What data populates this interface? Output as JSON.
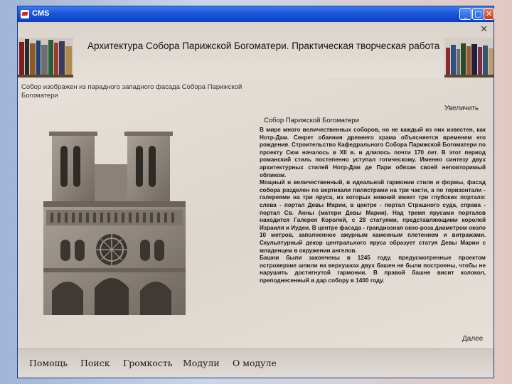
{
  "window": {
    "title": "CMS",
    "minimize_glyph": "_",
    "maximize_glyph": "□",
    "close_glyph": "✕",
    "inner_close_glyph": "✕"
  },
  "page": {
    "title": "Архитектура Собора Парижской Богоматери. Практическая творческая работа",
    "caption": "Собор изображен из парадного западного фасада Собора Парижской Богоматери",
    "enlarge_label": "Увеличить",
    "article_title": "Собор Парижской Богоматери",
    "article_text": "В мире много величественных соборов, но не каждый из них известен, как Нотр-Дам. Секрет обаяния древнего храма объясняется временем его рождения. Строительство Кафедрального Собора Парижской Богоматери по проекту Сюи началось в XII в. и длилось почти 170 лет. В этот период романский стиль постепенно уступал готическому. Именно синтезу двух архитектурных стилей Нотр-Дам де Пари обязан своей неповторимый обликом.\nМощный и величественный, в идеальной гармонии стиля и формы, фасад собора разделен по вертикали пилястрами на три части, а по горизонтали - галереями на три яруса, из которых нижний имеет три глубоких портала: слева - портал Девы Марии, в центре - портал Страшного суда, справа - портал Св. Анны (матери Девы Марии). Над тремя ярусами порталов находится Галерея Королей, с 28 статуями, представляющими королей Израиля и Иудеи. В центре фасада - грандиозная окно-роза диаметром около 10 метров, заполненное ажурным каменным плетением и витражами. Скульптурный декор центрального яруса образует статуя Девы Марии с младенцем в окружении ангелов.\nБашни были закончены в 1245 году, предусмотренные проектом островерхие шпили на верхушках двух башен не были построены, чтобы не нарушить достигнутой гармонии. В правой башне висит колокол, преподнесенный в дар собору в 1400 году.",
    "next_label": "Далее"
  },
  "menu": {
    "items": [
      {
        "label": "Помощь"
      },
      {
        "label": "Поиск"
      },
      {
        "label": "Громкость"
      },
      {
        "label": "Модули"
      },
      {
        "label": "О модуле"
      }
    ]
  },
  "colors": {
    "titlebar": "#1d57d8",
    "content_bg": "#e3ddd6"
  }
}
